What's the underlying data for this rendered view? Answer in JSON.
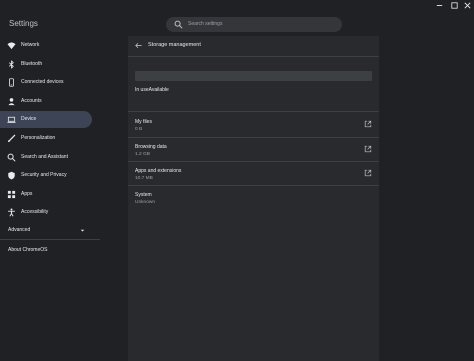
{
  "header": {
    "title": "Settings",
    "search_placeholder": "Search settings"
  },
  "sidebar": {
    "items": [
      {
        "label": "Network",
        "icon": "wifi-icon"
      },
      {
        "label": "Bluetooth",
        "icon": "bluetooth-icon"
      },
      {
        "label": "Connected devices",
        "icon": "phone-icon"
      },
      {
        "label": "Accounts",
        "icon": "person-icon"
      },
      {
        "label": "Device",
        "icon": "laptop-icon",
        "selected": true
      },
      {
        "label": "Personalization",
        "icon": "brush-icon"
      },
      {
        "label": "Search and Assistant",
        "icon": "search-icon"
      },
      {
        "label": "Security and Privacy",
        "icon": "shield-icon"
      },
      {
        "label": "Apps",
        "icon": "apps-grid-icon"
      },
      {
        "label": "Accessibility",
        "icon": "accessibility-icon"
      }
    ],
    "advanced_label": "Advanced",
    "about_label": "About ChromeOS"
  },
  "main": {
    "title": "Storage management",
    "usage_text": "In useAvailable",
    "rows": [
      {
        "title": "My files",
        "value": "0 B",
        "external": true
      },
      {
        "title": "Browsing data",
        "value": "1.2 GB",
        "external": true
      },
      {
        "title": "Apps and extensions",
        "value": "10.7 MB",
        "external": true
      },
      {
        "title": "System",
        "value": "Unknown",
        "external": false
      }
    ]
  },
  "colors": {
    "background": "#202124",
    "card": "#292a2d",
    "selected": "#3c4456",
    "text": "#e8eaed",
    "secondary_text": "#9aa0a6"
  }
}
